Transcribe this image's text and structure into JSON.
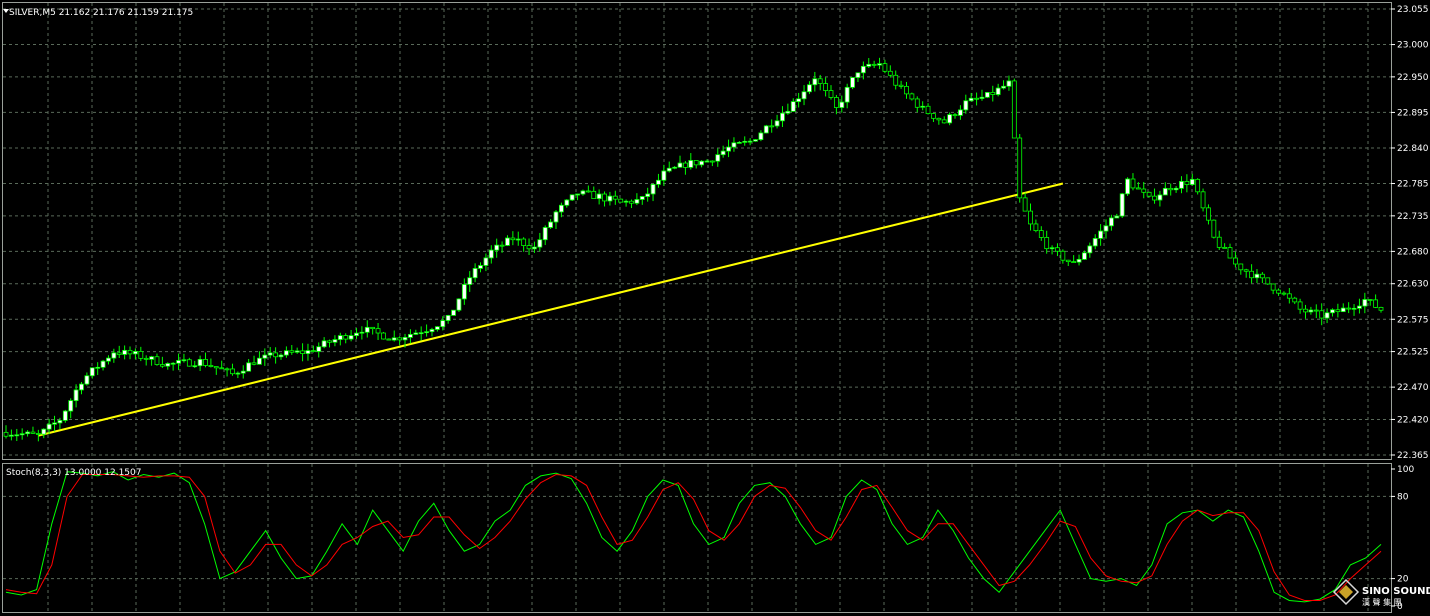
{
  "main_chart": {
    "header_text": "SILVER,M5  21.162 21.176 21.159 21.175",
    "price_ticks": [
      "23.055",
      "23.000",
      "22.950",
      "22.895",
      "22.840",
      "22.785",
      "22.735",
      "22.680",
      "22.630",
      "22.575",
      "22.525",
      "22.470",
      "22.420",
      "22.365"
    ]
  },
  "indicator": {
    "header_text": "Stoch(8,3,3) 13.0000 12.1507",
    "ticks": [
      "100",
      "80",
      "20",
      "0"
    ]
  },
  "watermark": {
    "brand": "SINO SOUND",
    "brand_cn": "漢 聲 集 團"
  },
  "chart_data": [
    {
      "type": "candlestick",
      "symbol": "SILVER",
      "timeframe": "M5",
      "ylim": [
        22.365,
        23.055
      ],
      "grid": true,
      "colors": {
        "background": "#000000",
        "bull": "#ffffff",
        "bear": "#000000",
        "wick": "#00ff00",
        "grid": "#5a6a5a",
        "trendline": "#ffff00"
      },
      "close_path": [
        [
          0,
          22.4
        ],
        [
          6,
          22.395
        ],
        [
          10,
          22.42
        ],
        [
          14,
          22.48
        ],
        [
          20,
          22.525
        ],
        [
          24,
          22.52
        ],
        [
          30,
          22.505
        ],
        [
          36,
          22.51
        ],
        [
          42,
          22.49
        ],
        [
          46,
          22.51
        ],
        [
          50,
          22.52
        ],
        [
          56,
          22.525
        ],
        [
          60,
          22.54
        ],
        [
          66,
          22.56
        ],
        [
          72,
          22.545
        ],
        [
          78,
          22.56
        ],
        [
          82,
          22.575
        ],
        [
          86,
          22.64
        ],
        [
          90,
          22.68
        ],
        [
          94,
          22.7
        ],
        [
          98,
          22.685
        ],
        [
          102,
          22.74
        ],
        [
          106,
          22.77
        ],
        [
          110,
          22.765
        ],
        [
          114,
          22.755
        ],
        [
          118,
          22.76
        ],
        [
          122,
          22.8
        ],
        [
          126,
          22.815
        ],
        [
          130,
          22.82
        ],
        [
          134,
          22.84
        ],
        [
          138,
          22.85
        ],
        [
          142,
          22.88
        ],
        [
          146,
          22.91
        ],
        [
          150,
          22.95
        ],
        [
          154,
          22.9
        ],
        [
          158,
          22.96
        ],
        [
          162,
          22.97
        ],
        [
          166,
          22.93
        ],
        [
          170,
          22.9
        ],
        [
          174,
          22.88
        ],
        [
          178,
          22.91
        ],
        [
          182,
          22.92
        ],
        [
          186,
          22.94
        ],
        [
          188,
          22.76
        ],
        [
          190,
          22.72
        ],
        [
          194,
          22.68
        ],
        [
          198,
          22.66
        ],
        [
          202,
          22.7
        ],
        [
          206,
          22.74
        ],
        [
          208,
          22.79
        ],
        [
          212,
          22.76
        ],
        [
          216,
          22.78
        ],
        [
          220,
          22.79
        ],
        [
          224,
          22.7
        ],
        [
          228,
          22.66
        ],
        [
          232,
          22.64
        ],
        [
          236,
          22.62
        ],
        [
          240,
          22.59
        ],
        [
          244,
          22.58
        ],
        [
          248,
          22.59
        ],
        [
          252,
          22.605
        ],
        [
          255,
          22.59
        ]
      ],
      "trendline": {
        "start": {
          "bar": 6,
          "price": 22.395
        },
        "end": {
          "bar": 196,
          "price": 22.785
        }
      }
    },
    {
      "type": "line",
      "name": "Stoch(8,3,3)",
      "ylim": [
        0,
        100
      ],
      "levels": [
        20,
        80
      ],
      "series": [
        {
          "name": "main",
          "color": "#00ff00",
          "values": [
            10,
            8,
            12,
            60,
            98,
            97,
            95,
            98,
            92,
            96,
            94,
            97,
            90,
            60,
            20,
            25,
            40,
            55,
            35,
            20,
            22,
            40,
            60,
            45,
            70,
            55,
            40,
            62,
            75,
            55,
            40,
            45,
            62,
            70,
            88,
            95,
            97,
            93,
            75,
            50,
            40,
            55,
            80,
            92,
            88,
            60,
            45,
            50,
            75,
            88,
            90,
            80,
            60,
            45,
            50,
            80,
            92,
            85,
            60,
            45,
            50,
            70,
            55,
            35,
            20,
            10,
            25,
            40,
            55,
            70,
            45,
            20,
            18,
            20,
            15,
            30,
            60,
            68,
            70,
            62,
            70,
            65,
            40,
            10,
            4,
            3,
            5,
            12,
            30,
            35,
            45
          ]
        },
        {
          "name": "signal",
          "color": "#ff0000",
          "values": [
            12,
            10,
            9,
            30,
            80,
            96,
            96,
            96,
            95,
            94,
            95,
            95,
            94,
            80,
            40,
            24,
            30,
            45,
            45,
            30,
            22,
            30,
            45,
            50,
            58,
            62,
            50,
            52,
            65,
            65,
            52,
            42,
            50,
            62,
            78,
            90,
            96,
            95,
            88,
            65,
            45,
            48,
            65,
            85,
            90,
            78,
            55,
            48,
            60,
            80,
            88,
            86,
            72,
            55,
            48,
            65,
            85,
            88,
            72,
            55,
            48,
            60,
            60,
            45,
            30,
            15,
            18,
            30,
            45,
            62,
            58,
            35,
            22,
            18,
            17,
            22,
            45,
            62,
            70,
            66,
            68,
            68,
            55,
            25,
            8,
            4,
            4,
            8,
            20,
            30,
            40
          ]
        }
      ]
    }
  ]
}
